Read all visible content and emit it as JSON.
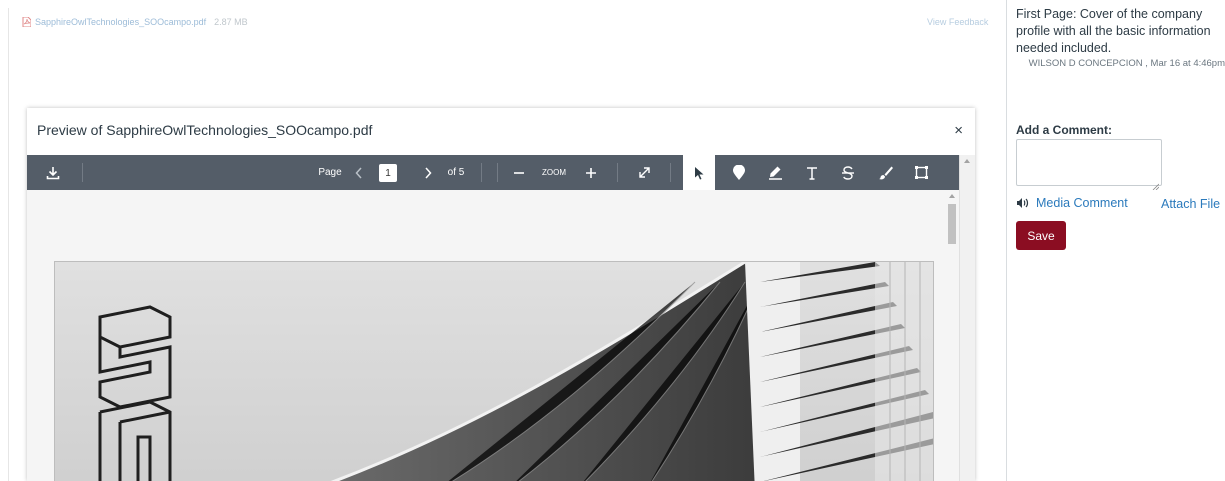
{
  "submission": {
    "file_name": "SapphireOwlTechnologies_SOOcampo.pdf",
    "file_size": "2.87 MB",
    "view_feedback": "View Feedback"
  },
  "comments": {
    "existing": {
      "text": "First Page: Cover of the company profile with all the basic information needed included.",
      "author": "WILSON D CONCEPCION",
      "date": ", Mar 16 at 4:46pm"
    },
    "add_label": "Add a Comment:",
    "media_comment": "Media Comment",
    "attach_file": "Attach File",
    "save": "Save"
  },
  "modal": {
    "title": "Preview of SapphireOwlTechnologies_SOOcampo.pdf",
    "close": "×"
  },
  "toolbar": {
    "page_label": "Page",
    "page_value": "1",
    "page_total": "of 5",
    "zoom_label": "ZOOM"
  },
  "colors": {
    "toolbar_bg": "#545d68",
    "save_button": "#8b0d22",
    "link": "#2b7abc"
  }
}
